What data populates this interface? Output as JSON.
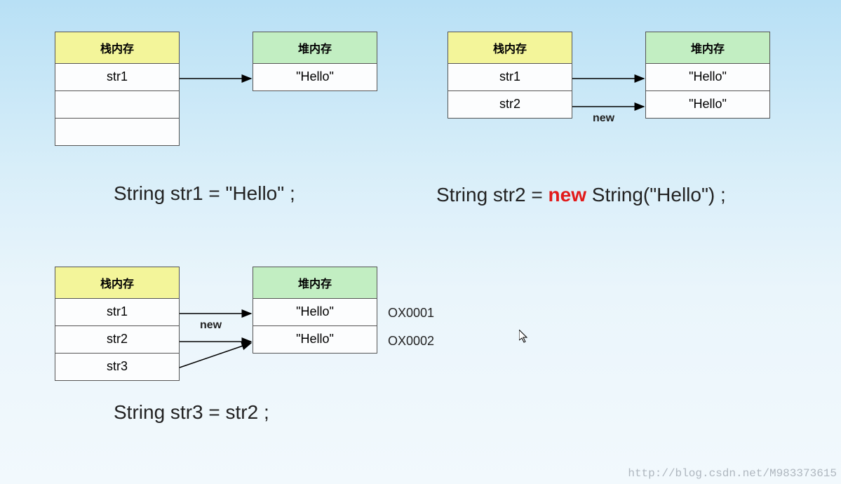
{
  "labels": {
    "stack": "栈内存",
    "heap": "堆内存",
    "new": "new"
  },
  "diagram1": {
    "stack": [
      "str1",
      "",
      ""
    ],
    "heap": [
      "\"Hello\""
    ],
    "code": "String str1 = \"Hello\" ;"
  },
  "diagram2": {
    "stack": [
      "str1",
      "str2"
    ],
    "heap": [
      "\"Hello\"",
      "\"Hello\""
    ],
    "code_pre": "String str2 = ",
    "code_new": "new",
    "code_post": " String(\"Hello\") ;"
  },
  "diagram3": {
    "stack": [
      "str1",
      "str2",
      "str3"
    ],
    "heap": [
      "\"Hello\"",
      "\"Hello\""
    ],
    "addr": [
      "OX0001",
      "OX0002"
    ],
    "code": "String str3 = str2 ;"
  },
  "watermark": "http://blog.csdn.net/M983373615"
}
